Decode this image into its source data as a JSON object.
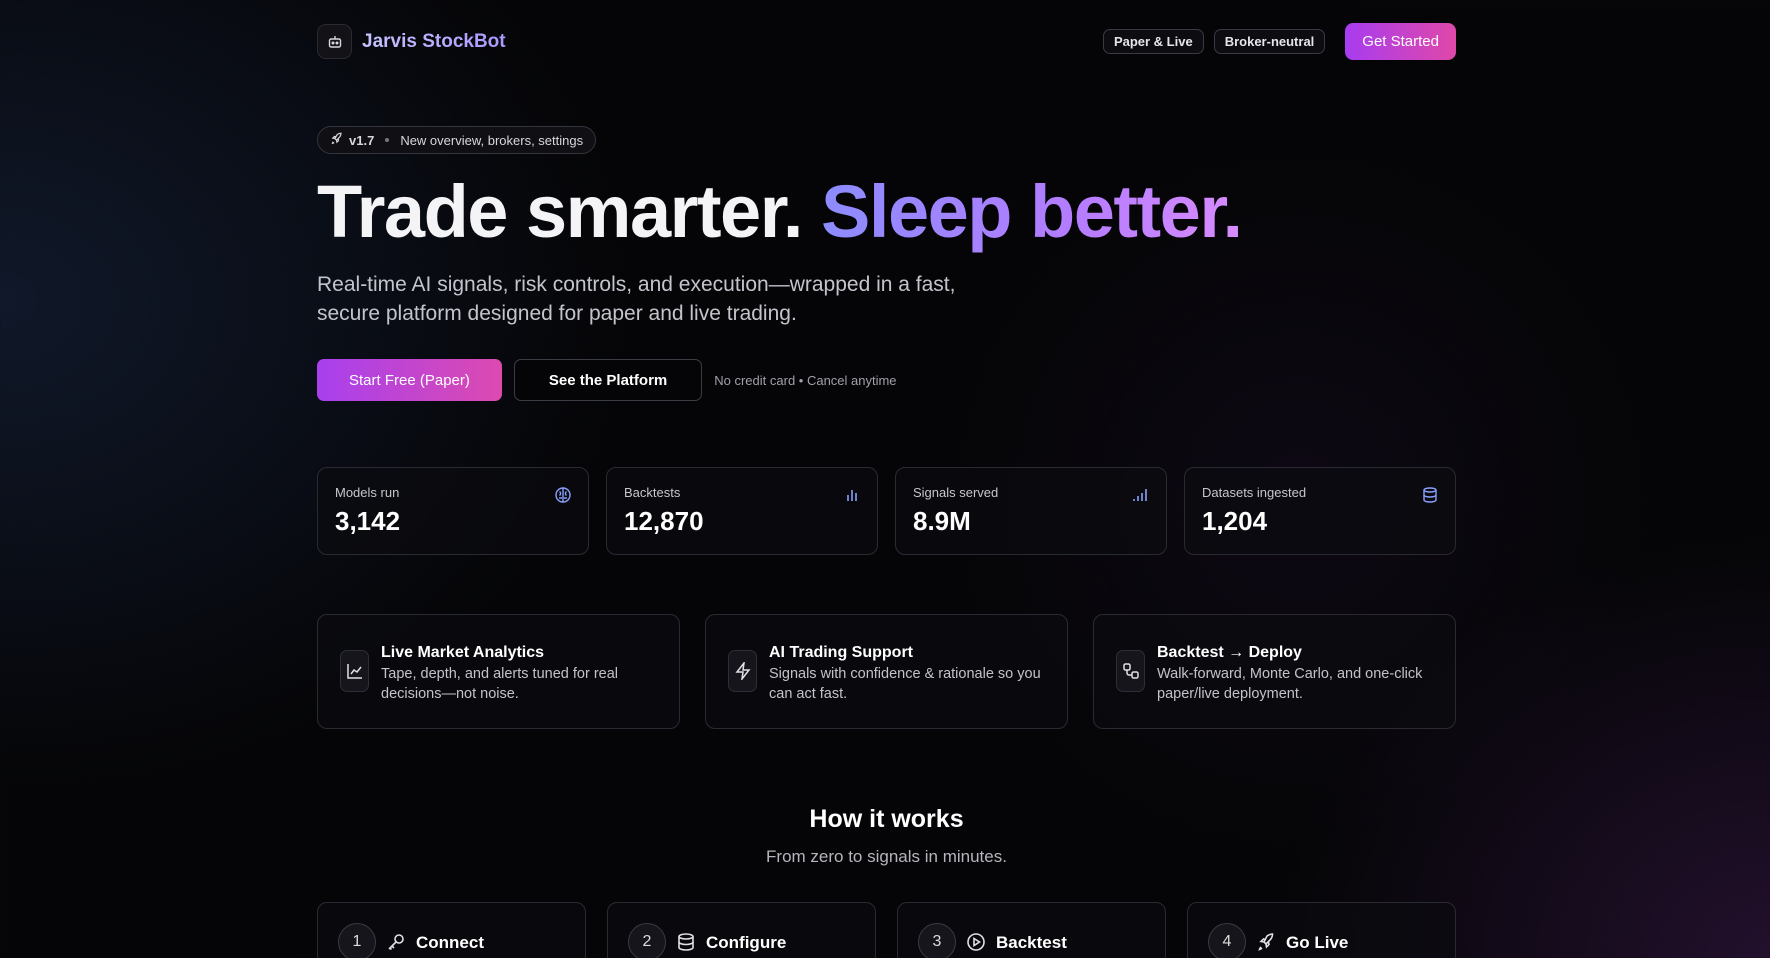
{
  "nav": {
    "brand": "Jarvis StockBot",
    "pills": [
      "Paper & Live",
      "Broker-neutral"
    ],
    "cta": "Get Started"
  },
  "hero": {
    "release_version": "v1.7",
    "release_note": "New overview, brokers, settings",
    "headline_plain": "Trade smarter.",
    "headline_gradient": "Sleep better.",
    "subtitle": "Real-time AI signals, risk controls, and execution—wrapped in a fast, secure platform designed for paper and live trading.",
    "primary_cta": "Start Free (Paper)",
    "secondary_cta": "See the Platform",
    "note": "No credit card • Cancel anytime"
  },
  "stats": [
    {
      "label": "Models run",
      "value": "3,142",
      "icon": "brain-icon"
    },
    {
      "label": "Backtests",
      "value": "12,870",
      "icon": "bar-chart-icon"
    },
    {
      "label": "Signals served",
      "value": "8.9M",
      "icon": "signal-bars-icon"
    },
    {
      "label": "Datasets ingested",
      "value": "1,204",
      "icon": "database-icon"
    }
  ],
  "features": [
    {
      "title": "Live Market Analytics",
      "desc": "Tape, depth, and alerts tuned for real decisions—not noise.",
      "icon": "line-chart-icon"
    },
    {
      "title": "AI Trading Support",
      "desc": "Signals with confidence & rationale so you can act fast.",
      "icon": "lightning-icon"
    },
    {
      "title": "Backtest → Deploy",
      "desc": "Walk-forward, Monte Carlo, and one-click paper/live deployment.",
      "icon": "workflow-icon"
    }
  ],
  "how": {
    "title": "How it works",
    "subtitle": "From zero to signals in minutes.",
    "steps": [
      {
        "num": "1",
        "label": "Connect",
        "icon": "key-icon"
      },
      {
        "num": "2",
        "label": "Configure",
        "icon": "database-icon"
      },
      {
        "num": "3",
        "label": "Backtest",
        "icon": "play-circle-icon"
      },
      {
        "num": "4",
        "label": "Go Live",
        "icon": "rocket-icon"
      }
    ]
  },
  "colors": {
    "background": "#050507",
    "accent_purple": "#a840ee",
    "accent_pink": "#dc4ab0",
    "stat_icon_blue": "#8aa0ff"
  }
}
